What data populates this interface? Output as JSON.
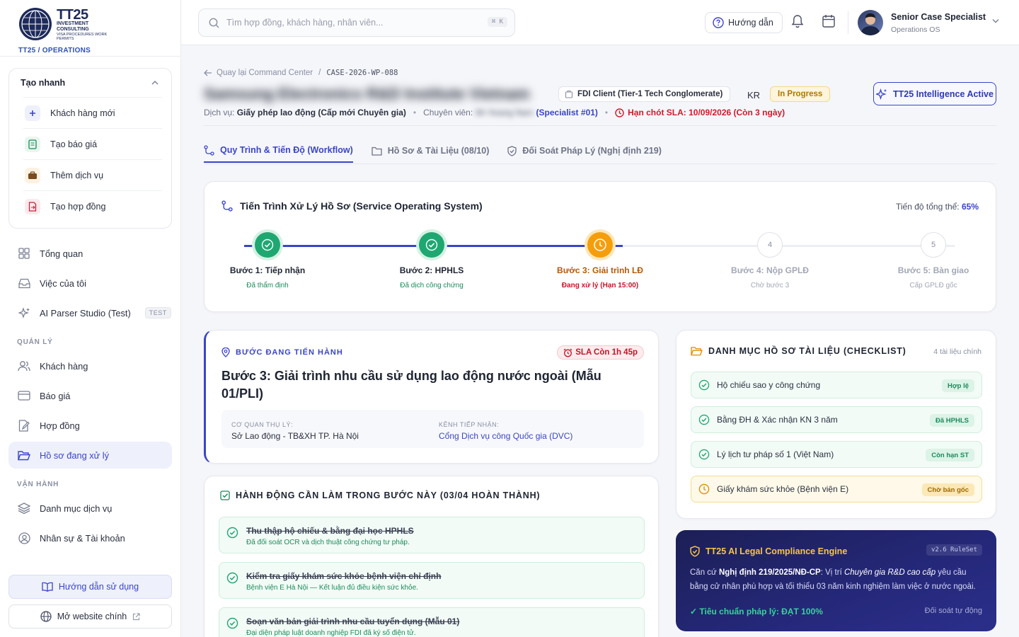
{
  "sidebar": {
    "brand": "TT25",
    "brand_sub": "INVESTMENT CONSULTING",
    "brand_tag": "VISA PROCEDURES WORK PERMITS",
    "ops_label": "TT25 / OPERATIONS",
    "quick_title": "Tạo nhanh",
    "quick_items": [
      {
        "label": "Khách hàng mới",
        "icon": "plus-icon"
      },
      {
        "label": "Tạo báo giá",
        "icon": "document-icon"
      },
      {
        "label": "Thêm dịch vụ",
        "icon": "briefcase-icon"
      },
      {
        "label": "Tạo hợp đồng",
        "icon": "contract-icon"
      }
    ],
    "nav_main": [
      {
        "label": "Tổng quan",
        "icon": "dashboard-icon"
      },
      {
        "label": "Việc của tôi",
        "icon": "inbox-icon"
      },
      {
        "label": "AI Parser Studio (Test)",
        "icon": "sparkle-icon",
        "tag": "TEST"
      }
    ],
    "section_manage": "QUẢN LÝ",
    "nav_manage": [
      {
        "label": "Khách hàng",
        "icon": "users-icon"
      },
      {
        "label": "Báo giá",
        "icon": "card-icon"
      },
      {
        "label": "Hợp đồng",
        "icon": "contract-icon"
      },
      {
        "label": "Hồ sơ đang xử lý",
        "icon": "folder-icon",
        "active": true
      }
    ],
    "section_ops": "VẬN HÀNH",
    "nav_ops": [
      {
        "label": "Danh mục dịch vụ",
        "icon": "layers-icon"
      },
      {
        "label": "Nhân sự & Tài khoản",
        "icon": "user-circle-icon"
      }
    ],
    "help_label": "Hướng dẫn sử dụng",
    "site_label": "Mở website chính"
  },
  "header": {
    "search_placeholder": "Tìm hợp đồng, khách hàng, nhân viên...",
    "search_shortcut": "⌘ K",
    "help_label": "Hướng dẫn",
    "user_name": "Senior Case Specialist",
    "user_role": "Operations OS"
  },
  "case": {
    "back_label": "Quay lại Command Center",
    "case_id": "CASE-2026-WP-088",
    "title": "Samsung Electronics R&D Institute Vietnam",
    "client_tier": "FDI Client (Tier-1 Tech Conglomerate)",
    "country": "KR",
    "status": "In Progress",
    "ai_active": "TT25 Intelligence Active",
    "service_label": "Dịch vụ:",
    "service_value": "Giấy phép lao động (Cấp mới Chuyên gia)",
    "specialist_label": "Chuyên viên:",
    "specialist_name": "Mr Hoang Nam",
    "specialist_tag": "(Specialist #01)",
    "deadline": "Hạn chót SLA: 10/09/2026 (Còn 3 ngày)"
  },
  "tabs": [
    {
      "label": "Quy Trình & Tiến Độ (Workflow)",
      "icon": "workflow-icon",
      "active": true
    },
    {
      "label": "Hồ Sơ & Tài Liệu (08/10)",
      "icon": "folder-icon"
    },
    {
      "label": "Đối Soát Pháp Lý (Nghị định 219)",
      "icon": "shield-icon"
    }
  ],
  "progress": {
    "title": "Tiến Trình Xử Lý Hồ Sơ (Service Operating System)",
    "overall_label": "Tiến độ tổng thể:",
    "overall_value": "65%",
    "overall_fraction": 0.65,
    "steps": [
      {
        "label": "Bước 1: Tiếp nhận",
        "sub": "Đã thẩm định",
        "state": "done"
      },
      {
        "label": "Bước 2: HPHLS",
        "sub": "Đã dịch công chứng",
        "state": "done"
      },
      {
        "label": "Bước 3: Giải trình LĐ",
        "sub": "Đang xử lý (Hạn 15:00)",
        "state": "current"
      },
      {
        "label": "Bước 4: Nộp GPLĐ",
        "sub": "Chờ bước 3",
        "state": "todo",
        "num": "4"
      },
      {
        "label": "Bước 5: Bàn giao",
        "sub": "Cấp GPLĐ gốc",
        "state": "todo",
        "num": "5"
      }
    ]
  },
  "current_step": {
    "label": "BƯỚC ĐANG TIẾN HÀNH",
    "sla": "SLA Còn 1h 45p",
    "title": "Bước 3: Giải trình nhu cầu sử dụng lao động nước ngoài (Mẫu 01/PLI)",
    "agency_key": "CƠ QUAN THỤ LÝ:",
    "agency_value": "Sở Lao động - TB&XH TP. Hà Nội",
    "channel_key": "KÊNH TIẾP NHẬN:",
    "channel_value": "Cổng Dịch vụ công Quốc gia (DVC)"
  },
  "actions": {
    "title": "HÀNH ĐỘNG CẦN LÀM TRONG BƯỚC NÀY (03/04 HOÀN THÀNH)",
    "items": [
      {
        "title": "Thu thập hộ chiếu & bằng đại học HPHLS",
        "sub": "Đã đối soát OCR và dịch thuật công chứng tư pháp."
      },
      {
        "title": "Kiểm tra giấy khám sức khỏe bệnh viện chỉ định",
        "sub": "Bệnh viện E Hà Nội — Kết luận đủ điều kiện sức khỏe."
      },
      {
        "title": "Soạn văn bản giải trình nhu cầu tuyển dụng (Mẫu 01)",
        "sub": "Đại diện pháp luật doanh nghiệp FDI đã ký số điện tử."
      }
    ]
  },
  "checklist": {
    "title": "DANH MỤC HỒ SƠ TÀI LIỆU (CHECKLIST)",
    "count": "4 tài liệu chính",
    "items": [
      {
        "label": "Hộ chiếu sao y công chứng",
        "badge": "Hợp lệ",
        "state": "ok"
      },
      {
        "label": "Bằng ĐH & Xác nhận KN 3 năm",
        "badge": "Đã HPHLS",
        "state": "ok"
      },
      {
        "label": "Lý lịch tư pháp số 1 (Việt Nam)",
        "badge": "Còn hạn ST",
        "state": "ok"
      },
      {
        "label": "Giấy khám sức khỏe (Bệnh viện E)",
        "badge": "Chờ bản gốc",
        "state": "warn"
      }
    ]
  },
  "ai_engine": {
    "title": "TT25 AI Legal Compliance Engine",
    "version": "v2.6 RuleSet",
    "basis_prefix": "Căn cứ ",
    "basis_decree": "Nghị định 219/2025/NĐ-CP",
    "basis_mid": ": Vị trí ",
    "basis_role": "Chuyên gia R&D cao cấp",
    "basis_rest": " yêu cầu bằng cử nhân phù hợp và tối thiểu 03 năm kinh nghiệm làm việc ở nước ngoài.",
    "result": "✓ Tiêu chuẩn pháp lý: ĐẠT 100%",
    "auto": "Đối soát tự động"
  },
  "colors": {
    "accent": "#3a45c8",
    "done": "#1fa772",
    "current": "#f59e0b",
    "danger": "#d11a2a"
  }
}
